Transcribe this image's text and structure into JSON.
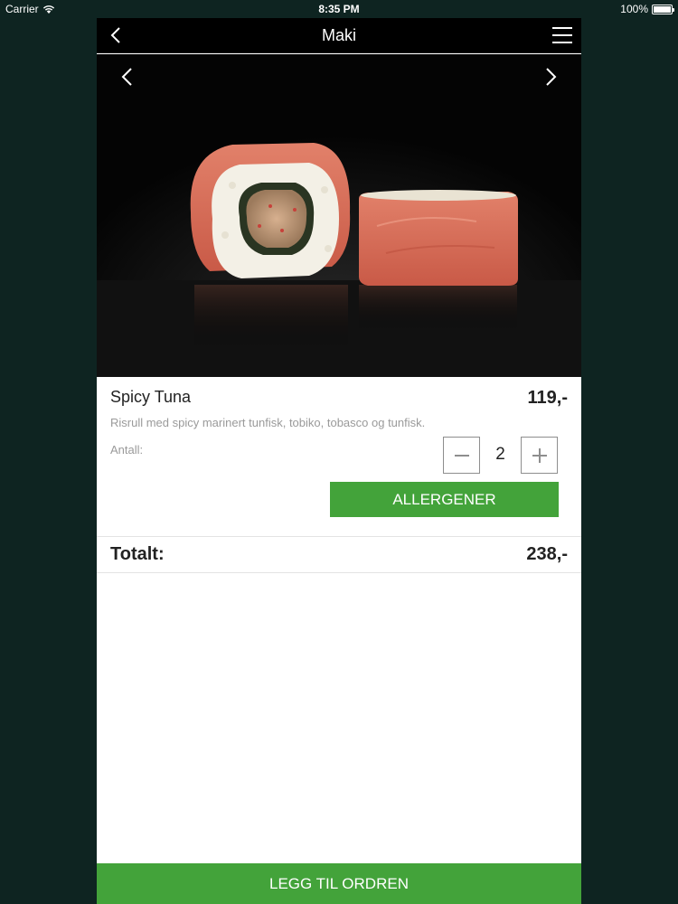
{
  "status_bar": {
    "carrier": "Carrier",
    "time": "8:35 PM",
    "battery": "100%",
    "battery_level": 1.0
  },
  "nav": {
    "title": "Maki",
    "back_icon": "chevron-left-icon",
    "menu_icon": "hamburger-menu-icon"
  },
  "hero": {
    "image_subject": "sushi-maki-rolls",
    "prev_icon": "chevron-left-icon",
    "next_icon": "chevron-right-icon"
  },
  "item": {
    "name": "Spicy Tuna",
    "price": "119,-",
    "description": "Risrull med spicy marinert tunfisk, tobiko, tobasco og tunfisk.",
    "quantity_label": "Antall:",
    "quantity": "2",
    "allergen_button": "ALLERGENER"
  },
  "total": {
    "label": "Totalt:",
    "value": "238,-"
  },
  "footer": {
    "add_button": "LEGG TIL ORDREN"
  },
  "colors": {
    "background": "#0e2421",
    "accent_green": "#43a33a",
    "nav_black": "#000000"
  }
}
